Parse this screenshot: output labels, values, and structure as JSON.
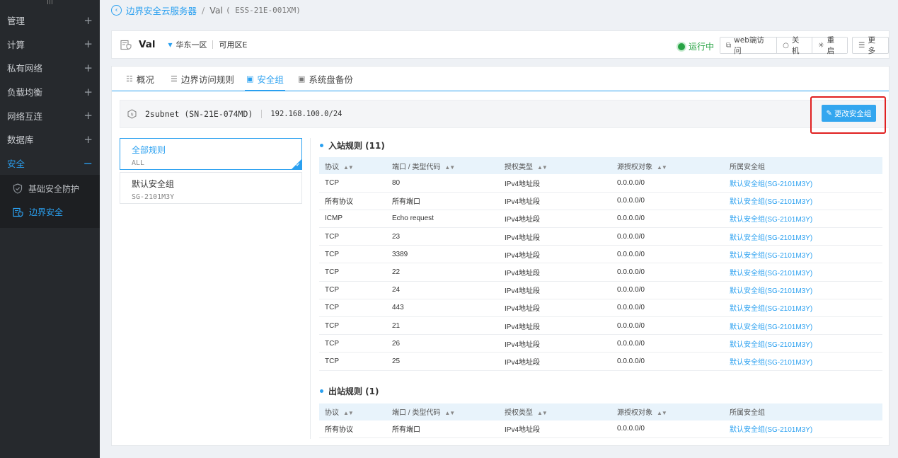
{
  "sidebar": {
    "items": [
      {
        "label": "管理"
      },
      {
        "label": "计算"
      },
      {
        "label": "私有网络"
      },
      {
        "label": "负载均衡"
      },
      {
        "label": "网络互连"
      },
      {
        "label": "数据库"
      }
    ],
    "expand_symbol": "+",
    "active": {
      "label": "安全",
      "symbol": "−"
    },
    "subitems": [
      {
        "label": "基础安全防护",
        "icon": "shield-icon"
      },
      {
        "label": "边界安全",
        "icon": "edge-security-icon"
      }
    ]
  },
  "breadcrumb": {
    "parent": "边界安全云服务器",
    "separator": "/",
    "current": "Val",
    "current_id": "( ESS-21E-001XM)"
  },
  "header": {
    "name": "Val",
    "region": "华东一区",
    "zone": "可用区E",
    "status": "运行中",
    "status_color": "#27a344",
    "buttons": {
      "web": "web端访问",
      "shutdown": "关机",
      "restart": "重启",
      "more": "更多"
    }
  },
  "tabs": [
    {
      "label": "概况"
    },
    {
      "label": "边界访问规则"
    },
    {
      "label": "安全组"
    },
    {
      "label": "系统盘备份"
    }
  ],
  "subnet": {
    "name": "2subnet (SN-21E-074MD)",
    "cidr": "192.168.100.0/24",
    "change_button": "更改安全组"
  },
  "security_groups": [
    {
      "title": "全部规则",
      "sub": "ALL"
    },
    {
      "title": "默认安全组",
      "sub": "SG-2101M3Y"
    }
  ],
  "inbound": {
    "title": "入站规则 (11)",
    "headers": [
      "协议",
      "端口 / 类型代码",
      "授权类型",
      "源授权对象",
      "所属安全组"
    ],
    "rows": [
      [
        "TCP",
        "80",
        "IPv4地址段",
        "0.0.0.0/0",
        "默认安全组(SG-2101M3Y)"
      ],
      [
        "所有协议",
        "所有端口",
        "IPv4地址段",
        "0.0.0.0/0",
        "默认安全组(SG-2101M3Y)"
      ],
      [
        "ICMP",
        "Echo request",
        "IPv4地址段",
        "0.0.0.0/0",
        "默认安全组(SG-2101M3Y)"
      ],
      [
        "TCP",
        "23",
        "IPv4地址段",
        "0.0.0.0/0",
        "默认安全组(SG-2101M3Y)"
      ],
      [
        "TCP",
        "3389",
        "IPv4地址段",
        "0.0.0.0/0",
        "默认安全组(SG-2101M3Y)"
      ],
      [
        "TCP",
        "22",
        "IPv4地址段",
        "0.0.0.0/0",
        "默认安全组(SG-2101M3Y)"
      ],
      [
        "TCP",
        "24",
        "IPv4地址段",
        "0.0.0.0/0",
        "默认安全组(SG-2101M3Y)"
      ],
      [
        "TCP",
        "443",
        "IPv4地址段",
        "0.0.0.0/0",
        "默认安全组(SG-2101M3Y)"
      ],
      [
        "TCP",
        "21",
        "IPv4地址段",
        "0.0.0.0/0",
        "默认安全组(SG-2101M3Y)"
      ],
      [
        "TCP",
        "26",
        "IPv4地址段",
        "0.0.0.0/0",
        "默认安全组(SG-2101M3Y)"
      ],
      [
        "TCP",
        "25",
        "IPv4地址段",
        "0.0.0.0/0",
        "默认安全组(SG-2101M3Y)"
      ]
    ]
  },
  "outbound": {
    "title": "出站规则 (1)",
    "headers": [
      "协议",
      "端口 / 类型代码",
      "授权类型",
      "源授权对象",
      "所属安全组"
    ],
    "rows": [
      [
        "所有协议",
        "所有端口",
        "IPv4地址段",
        "0.0.0.0/0",
        "默认安全组(SG-2101M3Y)"
      ]
    ]
  },
  "colors": {
    "accent": "#2aa0f0",
    "highlight_border": "#e02020",
    "sidebar_bg": "#26292d"
  }
}
